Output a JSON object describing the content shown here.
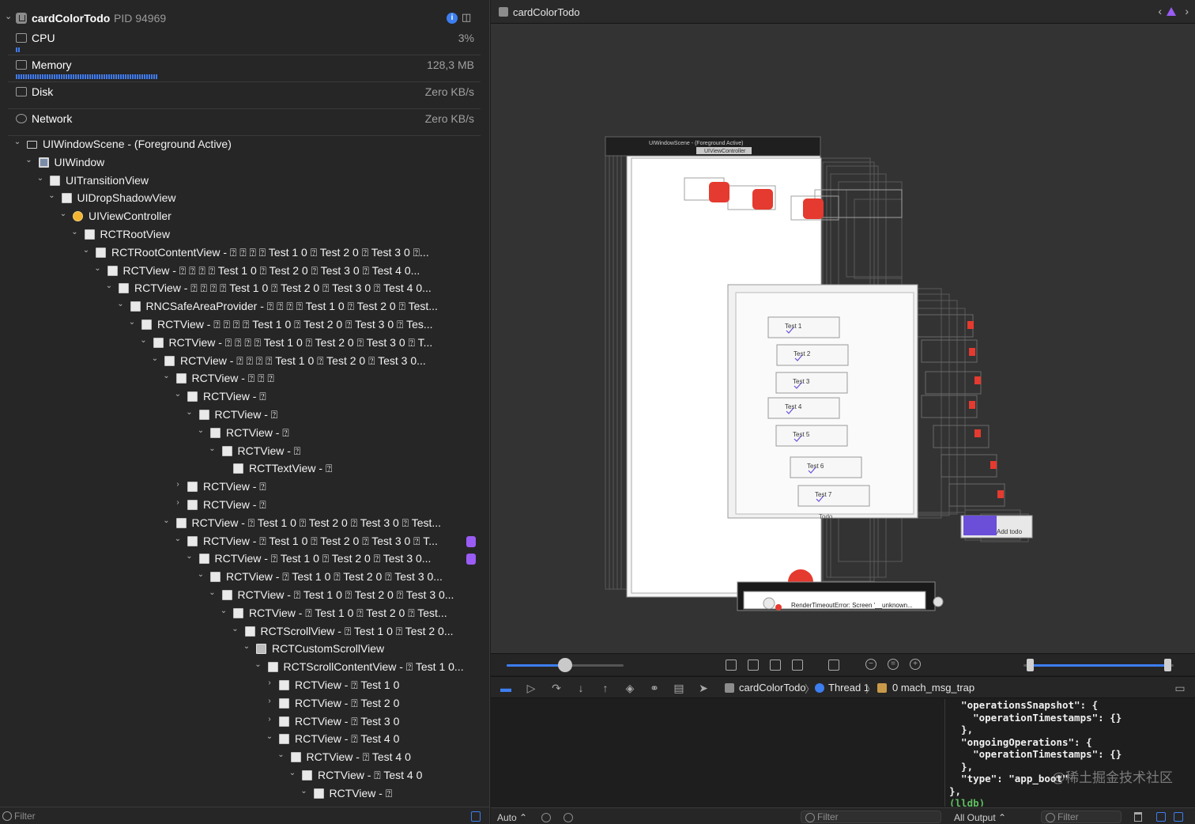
{
  "process": {
    "name": "cardColorTodo",
    "pid": "PID 94969"
  },
  "gauges": [
    {
      "name": "CPU",
      "value": "3%",
      "level": 0.01
    },
    {
      "name": "Memory",
      "value": "128,3 MB",
      "level": 0.31
    },
    {
      "name": "Disk",
      "value": "Zero KB/s",
      "level": 0
    },
    {
      "name": "Network",
      "value": "Zero KB/s",
      "level": 0
    }
  ],
  "tree": [
    {
      "label": "UIWindowScene - (Foreground Active)",
      "depth": 0,
      "icon": "scene",
      "chevron": "down"
    },
    {
      "label": "UIWindow",
      "depth": 1,
      "icon": "window",
      "chevron": "down"
    },
    {
      "label": "UITransitionView",
      "depth": 2,
      "icon": "view",
      "chevron": "down"
    },
    {
      "label": "UIDropShadowView",
      "depth": 3,
      "icon": "view",
      "chevron": "down"
    },
    {
      "label": "UIViewController",
      "depth": 4,
      "icon": "controller",
      "chevron": "down"
    },
    {
      "label": "RCTRootView",
      "depth": 5,
      "icon": "view",
      "chevron": "down"
    },
    {
      "label": "RCTRootContentView - ⍰ ⍰ ⍰ ⍰ Test 1 0 ⍰ Test 2 0 ⍰ Test 3 0 ⍰...",
      "depth": 6,
      "icon": "view",
      "chevron": "down"
    },
    {
      "label": "RCTView - ⍰ ⍰ ⍰ ⍰ Test 1 0 ⍰ Test 2 0 ⍰ Test 3 0 ⍰ Test 4 0...",
      "depth": 7,
      "icon": "view",
      "chevron": "down"
    },
    {
      "label": "RCTView - ⍰ ⍰ ⍰ ⍰ Test 1 0 ⍰ Test 2 0 ⍰ Test 3 0 ⍰ Test 4 0...",
      "depth": 8,
      "icon": "view",
      "chevron": "down"
    },
    {
      "label": "RNCSafeAreaProvider - ⍰ ⍰ ⍰ ⍰ Test 1 0 ⍰ Test 2 0 ⍰ Test...",
      "depth": 9,
      "icon": "view",
      "chevron": "down"
    },
    {
      "label": "RCTView - ⍰ ⍰ ⍰ ⍰ Test 1 0 ⍰ Test 2 0 ⍰ Test 3 0 ⍰ Tes...",
      "depth": 10,
      "icon": "view",
      "chevron": "down"
    },
    {
      "label": "RCTView - ⍰ ⍰ ⍰ ⍰ Test 1 0 ⍰ Test 2 0 ⍰ Test 3 0 ⍰ T...",
      "depth": 11,
      "icon": "view",
      "chevron": "down"
    },
    {
      "label": "RCTView - ⍰ ⍰ ⍰ ⍰ Test 1 0 ⍰ Test 2 0 ⍰ Test 3 0...",
      "depth": 12,
      "icon": "view",
      "chevron": "down"
    },
    {
      "label": "RCTView - ⍰ ⍰ ⍰",
      "depth": 13,
      "icon": "view",
      "chevron": "down"
    },
    {
      "label": "RCTView - ⍰",
      "depth": 14,
      "icon": "view",
      "chevron": "down"
    },
    {
      "label": "RCTView - ⍰",
      "depth": 15,
      "icon": "view",
      "chevron": "down"
    },
    {
      "label": "RCTView - ⍰",
      "depth": 16,
      "icon": "view",
      "chevron": "down"
    },
    {
      "label": "RCTView - ⍰",
      "depth": 17,
      "icon": "view",
      "chevron": "down"
    },
    {
      "label": "RCTTextView - ⍰",
      "depth": 18,
      "icon": "view",
      "chevron": "none"
    },
    {
      "label": "RCTView - ⍰",
      "depth": 14,
      "icon": "view",
      "chevron": "right"
    },
    {
      "label": "RCTView - ⍰",
      "depth": 14,
      "icon": "view",
      "chevron": "right"
    },
    {
      "label": "RCTView - ⍰ Test 1 0 ⍰ Test 2 0 ⍰ Test 3 0 ⍰ Test...",
      "depth": 13,
      "icon": "view",
      "chevron": "down"
    },
    {
      "label": "RCTView - ⍰ Test 1 0 ⍰ Test 2 0 ⍰ Test 3 0 ⍰ T...",
      "depth": 14,
      "icon": "view",
      "chevron": "down",
      "badge": true
    },
    {
      "label": "RCTView - ⍰ Test 1 0 ⍰ Test 2 0 ⍰ Test 3 0...",
      "depth": 15,
      "icon": "view",
      "chevron": "down",
      "badge": true
    },
    {
      "label": "RCTView - ⍰ Test 1 0 ⍰ Test 2 0 ⍰ Test 3 0...",
      "depth": 16,
      "icon": "view",
      "chevron": "down"
    },
    {
      "label": "RCTView - ⍰ Test 1 0 ⍰ Test 2 0 ⍰ Test 3 0...",
      "depth": 17,
      "icon": "view",
      "chevron": "down"
    },
    {
      "label": "RCTView - ⍰ Test 1 0 ⍰ Test 2 0 ⍰ Test...",
      "depth": 18,
      "icon": "view",
      "chevron": "down"
    },
    {
      "label": "RCTScrollView - ⍰ Test 1 0 ⍰ Test 2 0...",
      "depth": 19,
      "icon": "view",
      "chevron": "down"
    },
    {
      "label": "RCTCustomScrollView",
      "depth": 20,
      "icon": "scroll",
      "chevron": "down"
    },
    {
      "label": "RCTScrollContentView - ⍰ Test 1 0...",
      "depth": 21,
      "icon": "view",
      "chevron": "down"
    },
    {
      "label": "RCTView - ⍰ Test 1 0",
      "depth": 22,
      "icon": "view",
      "chevron": "right"
    },
    {
      "label": "RCTView - ⍰ Test 2 0",
      "depth": 22,
      "icon": "view",
      "chevron": "right"
    },
    {
      "label": "RCTView - ⍰ Test 3 0",
      "depth": 22,
      "icon": "view",
      "chevron": "right"
    },
    {
      "label": "RCTView - ⍰ Test 4 0",
      "depth": 22,
      "icon": "view",
      "chevron": "down"
    },
    {
      "label": "RCTView - ⍰ Test 4 0",
      "depth": 23,
      "icon": "view",
      "chevron": "down"
    },
    {
      "label": "RCTView - ⍰ Test 4 0",
      "depth": 24,
      "icon": "view",
      "chevron": "down"
    },
    {
      "label": "RCTView - ⍰",
      "depth": 25,
      "icon": "view",
      "chevron": "down"
    }
  ],
  "navigator_filter": {
    "placeholder": "Filter"
  },
  "canvas": {
    "title": "cardColorTodo",
    "scene_label": "UIWindowScene - (Foreground Active)",
    "vc_label": "UIViewController",
    "todo_items": [
      "Test 1",
      "Test 2",
      "Test 3",
      "Test 4",
      "Test 5",
      "Test 6",
      "Test 7"
    ],
    "input_label": "Todo",
    "add_button_label": "Add todo",
    "error_label": "RenderTimeoutError: Screen '__unknown...",
    "colors": {
      "card_red": "#e53a2f",
      "add_button": "#6b4fd8",
      "accent": "#3d7ef0"
    }
  },
  "canvas_controls": {
    "spacing_level": 0.5,
    "range_start": 0.04,
    "range_end": 0.96
  },
  "debug_bar": {
    "app": "cardColorTodo",
    "thread": "Thread 1",
    "frame": "0 mach_msg_trap"
  },
  "console": {
    "lines": [
      "  \"operationsSnapshot\": {",
      "    \"operationTimestamps\": {}",
      "  },",
      "  \"ongoingOperations\": {",
      "    \"operationTimestamps\": {}",
      "  },",
      "  \"type\": \"app_boot\"",
      "},"
    ],
    "prompt": "(lldb)",
    "watermark": "@稀土掘金技术社区"
  },
  "bottom_bar": {
    "variables_scope": "Auto ⌃",
    "variables_filter_placeholder": "Filter",
    "output_scope": "All Output ⌃",
    "console_filter_placeholder": "Filter"
  }
}
